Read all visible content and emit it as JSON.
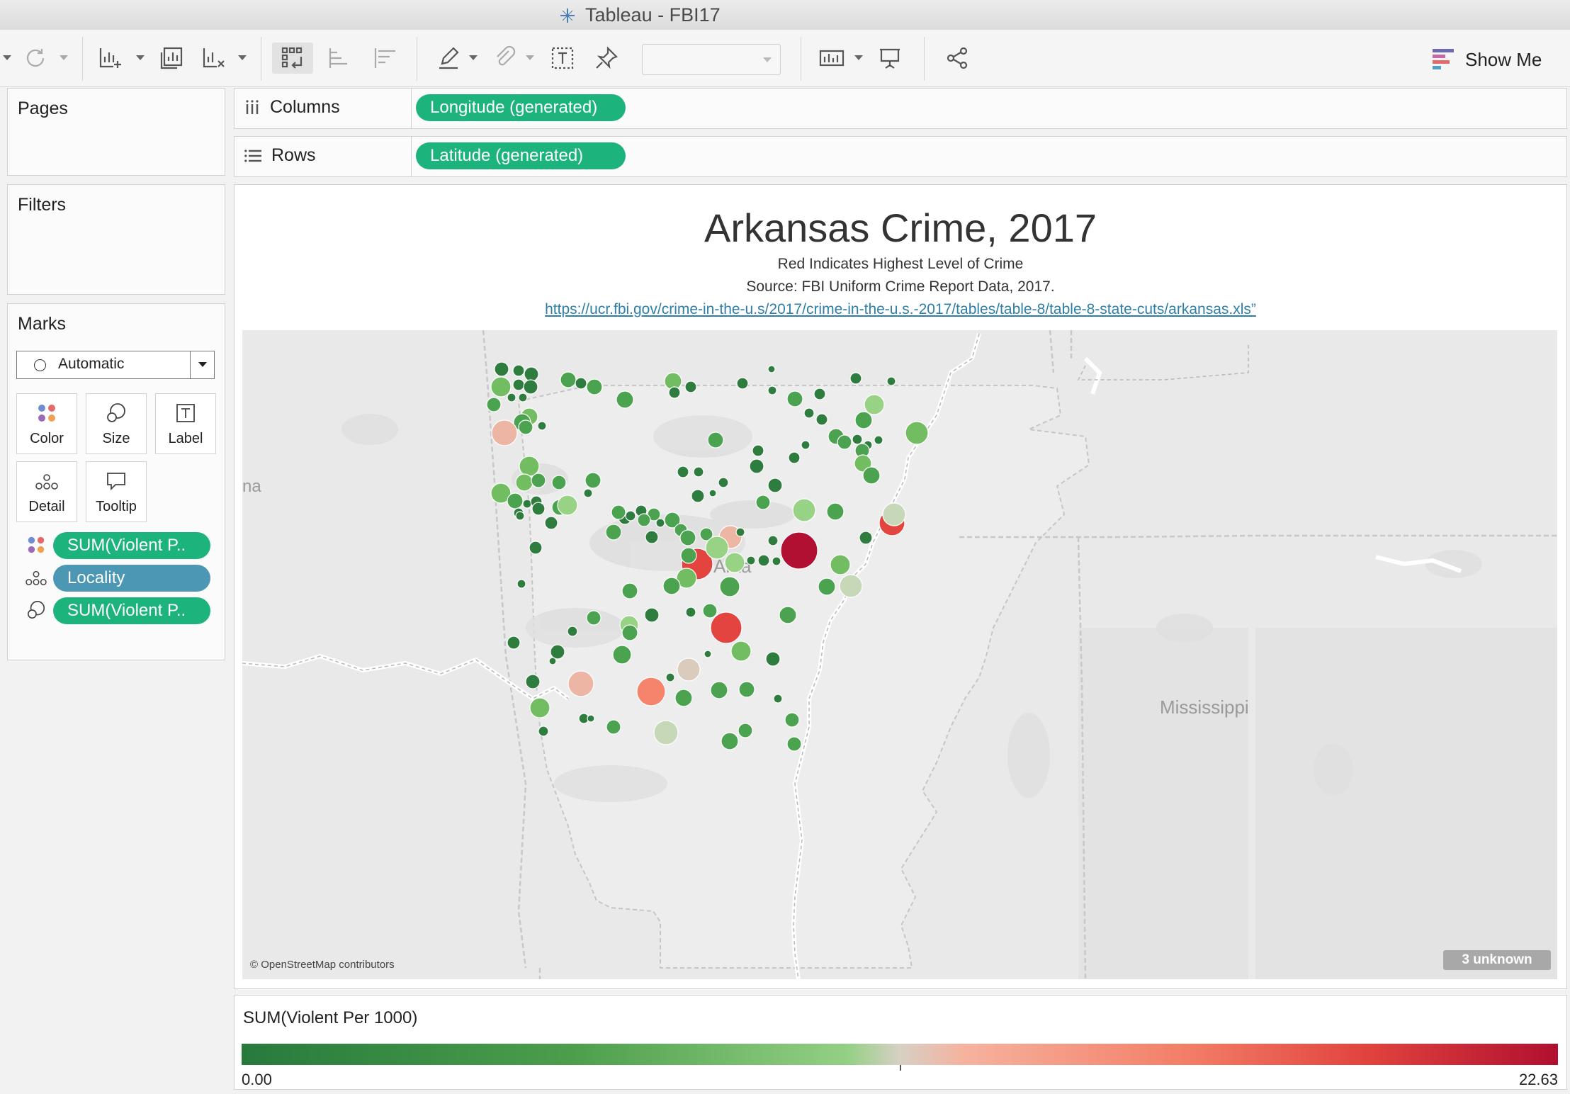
{
  "window": {
    "title": "Tableau - FBI17"
  },
  "toolbar": {
    "show_me_label": "Show Me",
    "icons": [
      "refresh-icon",
      "new-worksheet-icon",
      "duplicate-sheet-icon",
      "clear-sheet-icon",
      "swap-rows-columns-icon",
      "sort-ascending-icon",
      "sort-descending-icon",
      "highlight-icon",
      "group-icon",
      "label-icon",
      "pin-icon",
      "fit-icon",
      "presentation-icon",
      "share-icon"
    ]
  },
  "panels": {
    "pages": "Pages",
    "filters": "Filters",
    "marks": {
      "title": "Marks",
      "mark_type": "Automatic",
      "buttons": [
        "Color",
        "Size",
        "Label",
        "Detail",
        "Tooltip"
      ],
      "fields": [
        {
          "icon": "color-icon",
          "label": "SUM(Violent P..",
          "style": "green"
        },
        {
          "icon": "detail-icon",
          "label": "Locality",
          "style": "blue"
        },
        {
          "icon": "size-icon",
          "label": "SUM(Violent P..",
          "style": "green"
        }
      ]
    }
  },
  "shelves": {
    "columns": {
      "label": "Columns",
      "pill": "Longitude (generated)"
    },
    "rows": {
      "label": "Rows",
      "pill": "Latitude (generated)"
    }
  },
  "view": {
    "title": "Arkansas Crime, 2017",
    "subtitle1": "Red Indicates Highest Level of Crime",
    "subtitle2": "Source: FBI Uniform Crime Report Data, 2017.",
    "link": "https://ucr.fbi.gov/crime-in-the-u.s/2017/crime-in-the-u.s.-2017/tables/table-8/table-8-state-cuts/arkansas.xls”",
    "map_labels": {
      "arkansas": "Arka",
      "mississippi": "Mississippi",
      "left_edge": "na"
    },
    "attribution": "© OpenStreetMap contributors",
    "unknown_badge": "3 unknown"
  },
  "legend": {
    "title": "SUM(Violent Per 1000)",
    "min": "0.00",
    "max": "22.63",
    "colors": [
      "#277a3c",
      "#94d084",
      "#d6d0c4",
      "#f37d66",
      "#b0102f"
    ]
  }
}
